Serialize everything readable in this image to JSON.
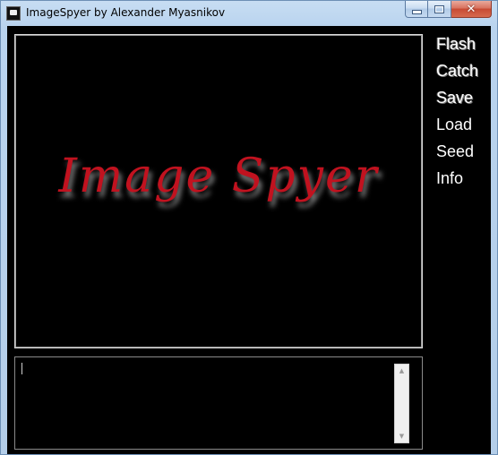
{
  "window": {
    "title": "ImageSpyer by Alexander Myasnikov",
    "buttons": {
      "minimize_icon": "minimize-icon",
      "maximize_icon": "maximize-icon",
      "close_glyph": "✕"
    }
  },
  "preview": {
    "logo_text": "Image Spyer",
    "logo_color": "#c1121f",
    "background": "#000000"
  },
  "menu": {
    "items": [
      {
        "label": "Flash"
      },
      {
        "label": "Catch"
      },
      {
        "label": "Save"
      },
      {
        "label": "Load"
      },
      {
        "label": "Seed"
      },
      {
        "label": "Info"
      }
    ]
  },
  "log": {
    "value": "",
    "scroll_up_glyph": "▲",
    "scroll_down_glyph": "▼"
  }
}
